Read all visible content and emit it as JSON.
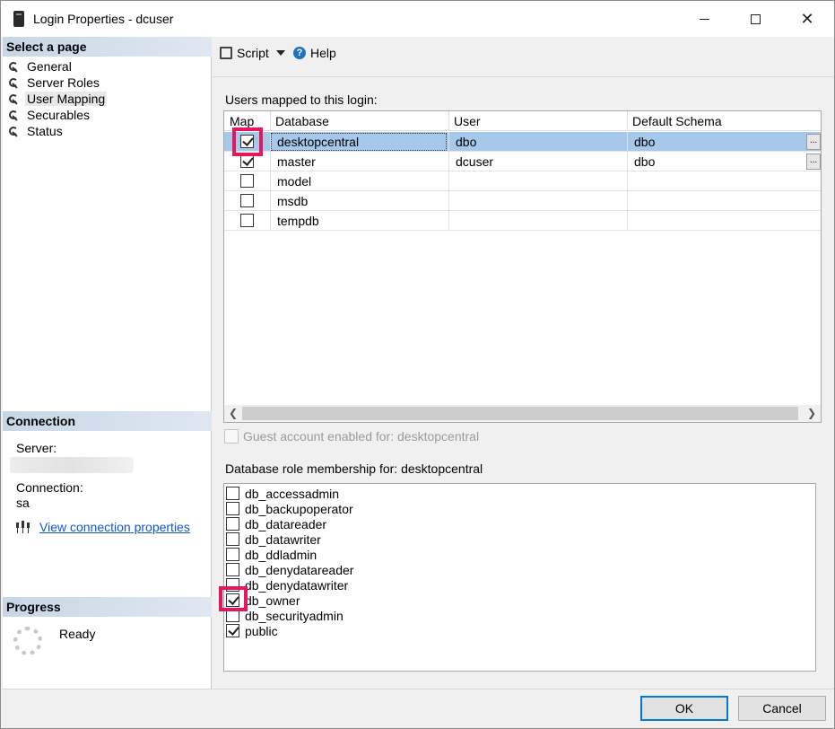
{
  "window": {
    "title": "Login Properties - dcuser"
  },
  "left_panel": {
    "select_page_header": "Select a page",
    "nav_items": [
      {
        "label": "General",
        "icon": "wrench-icon",
        "selected": false
      },
      {
        "label": "Server Roles",
        "icon": "wrench-icon",
        "selected": false
      },
      {
        "label": "User Mapping",
        "icon": "wrench-icon",
        "selected": true
      },
      {
        "label": "Securables",
        "icon": "wrench-icon",
        "selected": false
      },
      {
        "label": "Status",
        "icon": "wrench-icon",
        "selected": false
      }
    ],
    "connection_header": "Connection",
    "server_label": "Server:",
    "connection_label": "Connection:",
    "connection_value": "sa",
    "view_connection_link": "View connection properties",
    "progress_header": "Progress",
    "progress_status": "Ready"
  },
  "toolbar": {
    "script_label": "Script",
    "help_label": "Help"
  },
  "users_mapped": {
    "label": "Users mapped to this login:",
    "columns": [
      "Map",
      "Database",
      "User",
      "Default Schema"
    ],
    "rows": [
      {
        "mapped": true,
        "database": "desktopcentral",
        "user": "dbo",
        "schema": "dbo",
        "selected": true
      },
      {
        "mapped": true,
        "database": "master",
        "user": "dcuser",
        "schema": "dbo",
        "selected": false
      },
      {
        "mapped": false,
        "database": "model",
        "user": "",
        "schema": "",
        "selected": false
      },
      {
        "mapped": false,
        "database": "msdb",
        "user": "",
        "schema": "",
        "selected": false
      },
      {
        "mapped": false,
        "database": "tempdb",
        "user": "",
        "schema": "",
        "selected": false
      }
    ],
    "ellipsis": "..."
  },
  "guest": {
    "label": "Guest account enabled for: desktopcentral"
  },
  "roles": {
    "label": "Database role membership for: desktopcentral",
    "items": [
      {
        "label": "db_accessadmin",
        "checked": false
      },
      {
        "label": "db_backupoperator",
        "checked": false
      },
      {
        "label": "db_datareader",
        "checked": false
      },
      {
        "label": "db_datawriter",
        "checked": false
      },
      {
        "label": "db_ddladmin",
        "checked": false
      },
      {
        "label": "db_denydatareader",
        "checked": false
      },
      {
        "label": "db_denydatawriter",
        "checked": false
      },
      {
        "label": "db_owner",
        "checked": true
      },
      {
        "label": "db_securityadmin",
        "checked": false
      },
      {
        "label": "public",
        "checked": true
      }
    ]
  },
  "footer": {
    "ok_label": "OK",
    "cancel_label": "Cancel"
  },
  "colors": {
    "highlight": "#e8175d",
    "selection": "#a6c8ea",
    "link": "#1155cc"
  }
}
